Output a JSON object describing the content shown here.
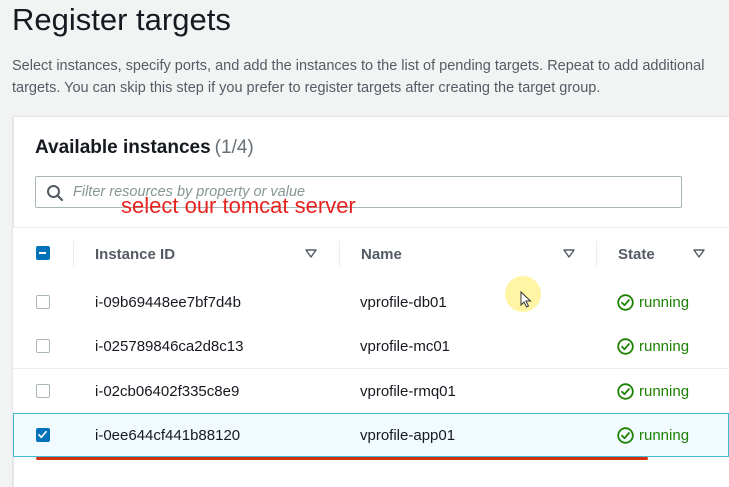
{
  "page": {
    "title": "Register targets",
    "description": "Select instances, specify ports, and add the instances to the list of pending targets. Repeat to add additional targets. You can skip this step if you prefer to register targets after creating the target group."
  },
  "panel": {
    "heading": "Available instances",
    "count": "(1/4)",
    "filter_placeholder": "Filter resources by property or value"
  },
  "annotation": "select our tomcat server",
  "table": {
    "columns": [
      "Instance ID",
      "Name",
      "State"
    ],
    "rows": [
      {
        "id": "i-09b69448ee7bf7d4b",
        "name": "vprofile-db01",
        "state": "running",
        "checked": false
      },
      {
        "id": "i-025789846ca2d8c13",
        "name": "vprofile-mc01",
        "state": "running",
        "checked": false
      },
      {
        "id": "i-02cb06402f335c8e9",
        "name": "vprofile-rmq01",
        "state": "running",
        "checked": false
      },
      {
        "id": "i-0ee644cf441b88120",
        "name": "vprofile-app01",
        "state": "running",
        "checked": true
      }
    ]
  },
  "icons": {
    "search": "search-icon",
    "sort": "sort-caret-icon",
    "status": "check-circle-icon"
  },
  "colors": {
    "accent": "#0073bb",
    "running": "#1d8102",
    "annotation": "#e8231f",
    "underline": "#d13212"
  }
}
